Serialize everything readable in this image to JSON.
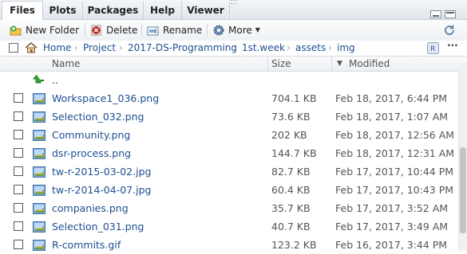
{
  "tabs": [
    "Files",
    "Plots",
    "Packages",
    "Help",
    "Viewer"
  ],
  "active_tab": "Files",
  "toolbar": {
    "new_folder": "New Folder",
    "delete": "Delete",
    "rename": "Rename",
    "more": "More"
  },
  "breadcrumb": [
    "Home",
    "Project",
    "2017-DS-Programming",
    "1st.week",
    "assets",
    "img"
  ],
  "columns": {
    "name": "Name",
    "size": "Size",
    "modified": "Modified"
  },
  "parent_dir": "..",
  "files": [
    {
      "name": "Workspace1_036.png",
      "size": "704.1 KB",
      "modified": "Feb 18, 2017, 6:44 PM"
    },
    {
      "name": "Selection_032.png",
      "size": "73.6 KB",
      "modified": "Feb 18, 2017, 1:07 AM"
    },
    {
      "name": "Community.png",
      "size": "202 KB",
      "modified": "Feb 18, 2017, 12:56 AM"
    },
    {
      "name": "dsr-process.png",
      "size": "144.7 KB",
      "modified": "Feb 18, 2017, 12:31 AM"
    },
    {
      "name": "tw-r-2015-03-02.jpg",
      "size": "82.7 KB",
      "modified": "Feb 17, 2017, 10:44 PM"
    },
    {
      "name": "tw-r-2014-04-07.jpg",
      "size": "60.4 KB",
      "modified": "Feb 17, 2017, 10:43 PM"
    },
    {
      "name": "companies.png",
      "size": "35.7 KB",
      "modified": "Feb 17, 2017, 3:52 AM"
    },
    {
      "name": "Selection_031.png",
      "size": "40.7 KB",
      "modified": "Feb 17, 2017, 3:49 AM"
    },
    {
      "name": "R-commits.gif",
      "size": "123.2 KB",
      "modified": "Feb 16, 2017, 3:44 PM"
    }
  ],
  "icons": {
    "home": "home-icon",
    "new_folder": "new-folder-icon",
    "delete": "delete-icon",
    "rename": "rename-icon",
    "more": "gear-icon",
    "refresh": "refresh-icon",
    "up": "up-arrow-icon",
    "image": "image-file-icon"
  },
  "colors": {
    "link": "#1d4f91",
    "tab_bg": "#e1e6ec",
    "up_arrow": "#2e9d2e"
  }
}
